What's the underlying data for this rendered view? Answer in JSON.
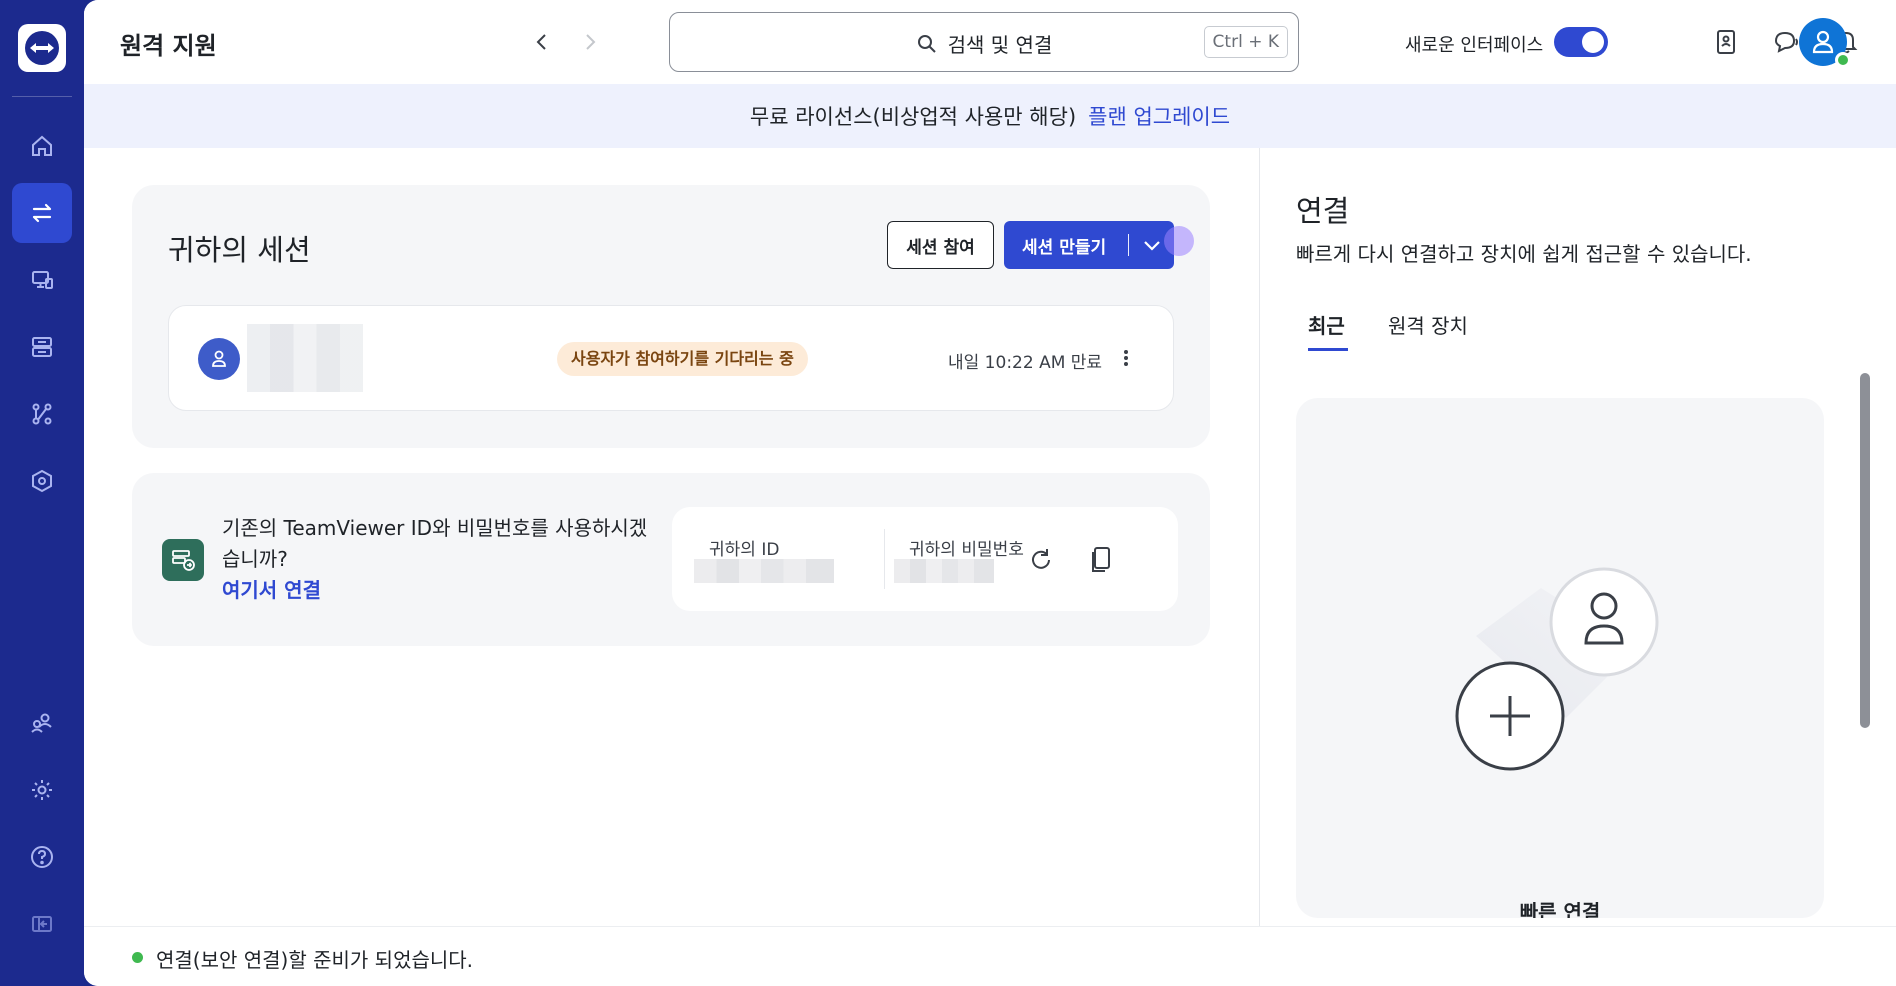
{
  "sidebar": {
    "logo_icon": "teamviewer-logo-icon",
    "items": [
      {
        "name": "home",
        "icon": "home-icon"
      },
      {
        "name": "remote-support",
        "icon": "arrows-exchange-icon",
        "active": true
      },
      {
        "name": "devices",
        "icon": "monitor-icon"
      },
      {
        "name": "sessions",
        "icon": "session-switch-icon"
      },
      {
        "name": "integrations",
        "icon": "workflow-icon"
      },
      {
        "name": "security",
        "icon": "hex-shield-icon"
      },
      {
        "name": "contacts",
        "icon": "people-icon"
      },
      {
        "name": "settings",
        "icon": "gear-icon"
      },
      {
        "name": "help",
        "icon": "help-icon"
      },
      {
        "name": "collapse",
        "icon": "collapse-sidebar-icon"
      }
    ]
  },
  "header": {
    "title": "원격 지원",
    "search_label": "검색 및 연결",
    "search_shortcut": "Ctrl + K",
    "new_ui_label": "새로운 인터페이스",
    "new_ui_enabled": true
  },
  "banner": {
    "text": "무료 라이선스(비상업적 사용만 해당)",
    "link": "플랜 업그레이드"
  },
  "sessions": {
    "title": "귀하의 세션",
    "join_button": "세션 참여",
    "create_button": "세션 만들기",
    "rows": [
      {
        "status": "사용자가 참여하기를 기다리는 중",
        "expiry": "내일 10:22 AM 만료"
      }
    ]
  },
  "legacy_id": {
    "prompt": "기존의 TeamViewer ID와 비밀번호를 사용하시겠습니까?",
    "link": "여기서 연결",
    "id_label": "귀하의 ID",
    "password_label": "귀하의 비밀번호"
  },
  "connect_panel": {
    "title": "연결",
    "subtitle": "빠르게 다시 연결하고 장치에 쉽게 접근할 수 있습니다.",
    "tabs": [
      {
        "label": "최근",
        "active": true
      },
      {
        "label": "원격 장치",
        "active": false
      }
    ],
    "quick_connect_label": "빠른 연결"
  },
  "status": {
    "text": "연결(보안 연결)할 준비가 되었습니다.",
    "color": "#3fb950"
  },
  "colors": {
    "brand": "#1c2a8e",
    "accent": "#2f49d1",
    "badge_bg": "#fdebd8"
  }
}
